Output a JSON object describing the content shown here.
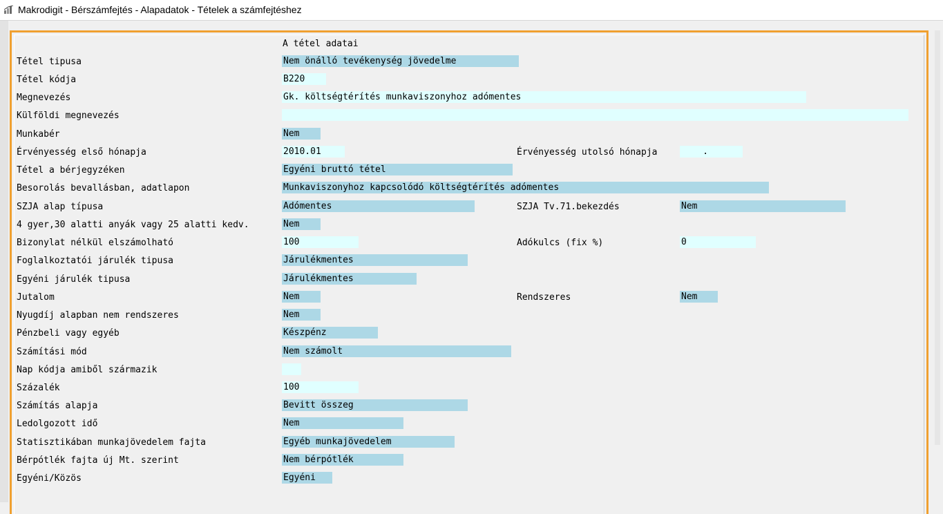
{
  "window": {
    "title": "Makrodigit - Bérszámfejtés  - Alapadatok - Tételek a számfejtéshez"
  },
  "section": {
    "heading": "A tétel adatai"
  },
  "rows": [
    {
      "label": "Tétel tipusa",
      "value": "Nem önálló tevékenység jövedelme"
    },
    {
      "label": "Tétel kódja",
      "value": "B220"
    },
    {
      "label": "Megnevezés",
      "value": "Gk. költségtérítés munkaviszonyhoz adómentes"
    },
    {
      "label": "Külföldi megnevezés",
      "value": ""
    },
    {
      "label": "Munkabér",
      "value": "Nem"
    },
    {
      "label": "Érvényesség első hónapja",
      "value": "2010.01",
      "label2": "Érvényesség utolsó hónapja",
      "value2": "    ."
    },
    {
      "label": "Tétel a bérjegyzéken",
      "value": "Egyéni bruttó tétel"
    },
    {
      "label": "Besorolás bevallásban, adatlapon",
      "value": "Munkaviszonyhoz kapcsolódó költségtérítés adómentes"
    },
    {
      "label": "SZJA alap típusa",
      "value": "Adómentes",
      "label2": "SZJA Tv.71.bekezdés",
      "value2": "Nem"
    },
    {
      "label": "4 gyer,30 alatti anyák vagy 25 alatti kedv.",
      "value": "Nem"
    },
    {
      "label": "Bizonylat nélkül elszámolható",
      "value": "100",
      "label2": "Adókulcs (fix %)",
      "value2": "0"
    },
    {
      "label": "Foglalkoztatói járulék tipusa",
      "value": "Járulékmentes"
    },
    {
      "label": "Egyéni járulék tipusa",
      "value": "Járulékmentes"
    },
    {
      "label": "Jutalom",
      "value": "Nem",
      "label2": "Rendszeres",
      "value2": "Nem"
    },
    {
      "label": "Nyugdíj alapban nem rendszeres",
      "value": "Nem"
    },
    {
      "label": "Pénzbeli vagy egyéb",
      "value": "Készpénz"
    },
    {
      "label": "Számítási mód",
      "value": "Nem számolt"
    },
    {
      "label": "Nap kódja amiből származik",
      "value": ""
    },
    {
      "label": "Százalék",
      "value": "100"
    },
    {
      "label": "Számítás alapja",
      "value": "Bevitt összeg"
    },
    {
      "label": "Ledolgozott idő",
      "value": "Nem"
    },
    {
      "label": "Statisztikában munkajövedelem fajta",
      "value": "Egyéb munkajövedelem"
    },
    {
      "label": "Bérpótlék fajta új Mt. szerint",
      "value": "Nem bérpótlék"
    },
    {
      "label": "Egyéni/Közös",
      "value": "Egyéni"
    }
  ],
  "colors": {
    "blue_field": "#add8e6",
    "cyan_field": "#e0ffff",
    "panel_border": "#f0a030"
  }
}
